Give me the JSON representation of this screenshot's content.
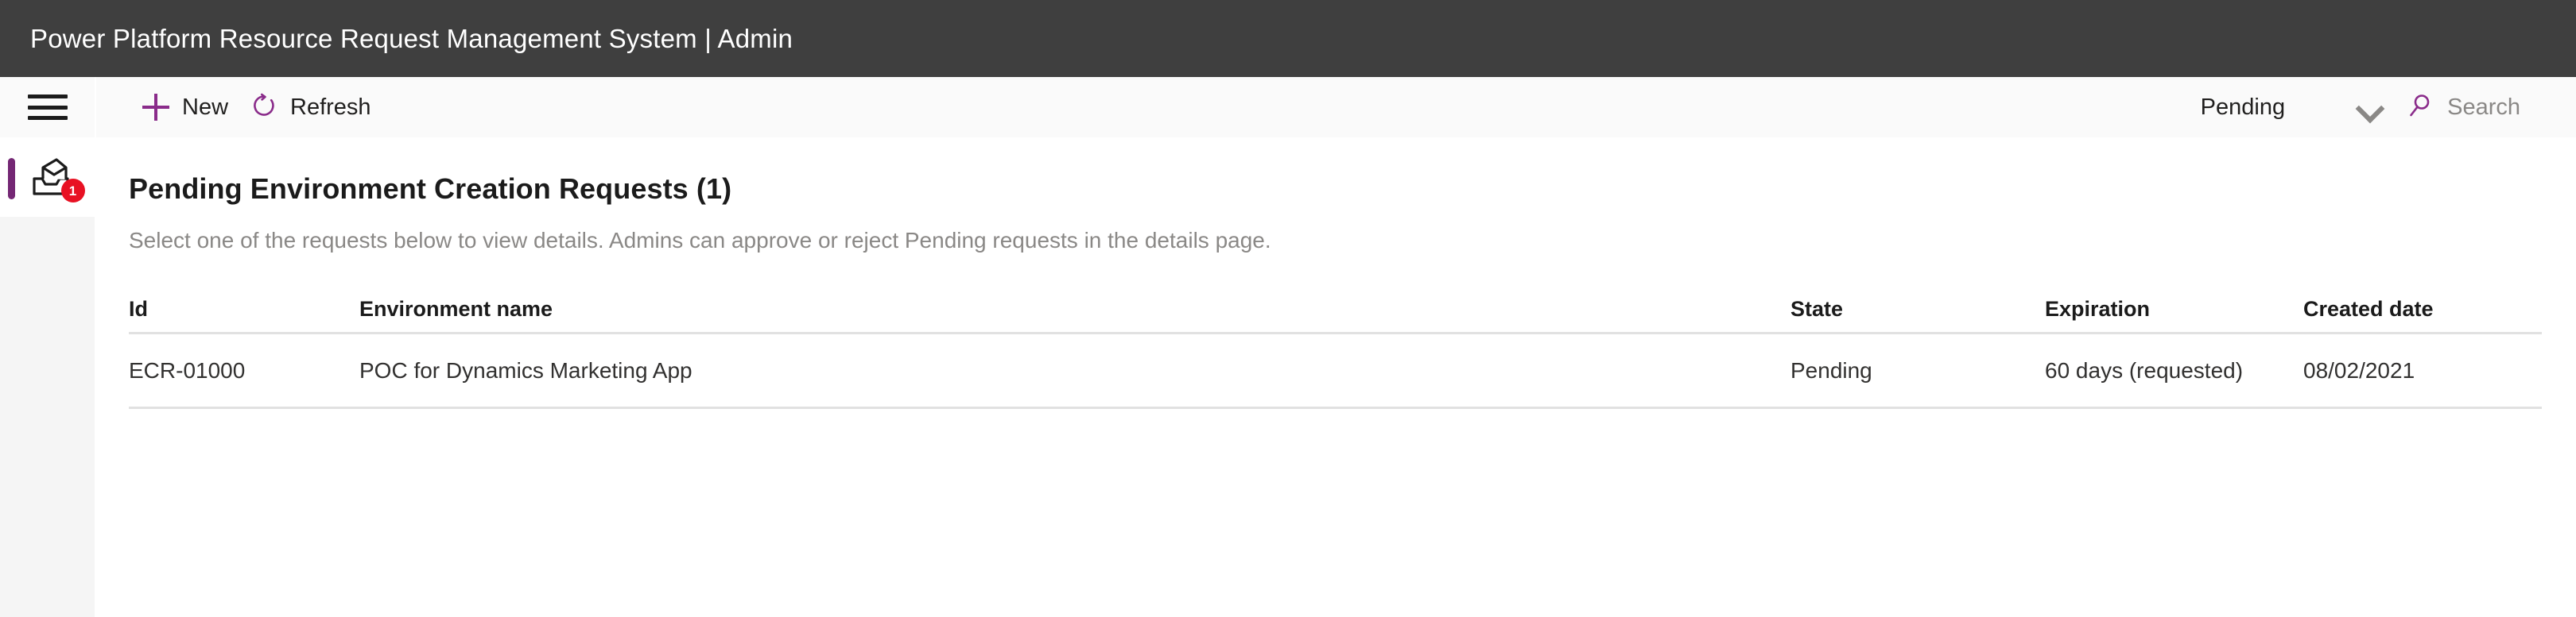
{
  "header": {
    "title": "Power Platform Resource Request Management System | Admin",
    "background_color": "#3f3f3f",
    "text_color": "#ffffff"
  },
  "rail": {
    "menu_icon": "hamburger-menu-icon",
    "items": [
      {
        "icon": "inbox-tray-icon",
        "badge_count": "1",
        "badge_color": "#e81123",
        "selected": true,
        "selection_color": "#742774"
      }
    ]
  },
  "commandbar": {
    "new_label": "New",
    "new_icon": "plus-icon",
    "refresh_label": "Refresh",
    "refresh_icon": "refresh-circular-arrow-icon",
    "accent_color": "#8a2b8a",
    "filter_value": "Pending",
    "filter_chevron_icon": "chevron-down-icon",
    "search_icon": "search-magnifier-icon",
    "search_placeholder": "Search",
    "search_value": ""
  },
  "main": {
    "title": "Pending Environment Creation Requests (1)",
    "subtitle": "Select one of the requests below to view details. Admins can approve or reject Pending requests in the details page.",
    "table": {
      "columns": [
        "Id",
        "Environment name",
        "State",
        "Expiration",
        "Created date"
      ],
      "rows": [
        {
          "id": "ECR-01000",
          "environment_name": "POC for Dynamics Marketing App",
          "state": "Pending",
          "expiration": "60 days (requested)",
          "created_date": "08/02/2021"
        }
      ]
    }
  }
}
